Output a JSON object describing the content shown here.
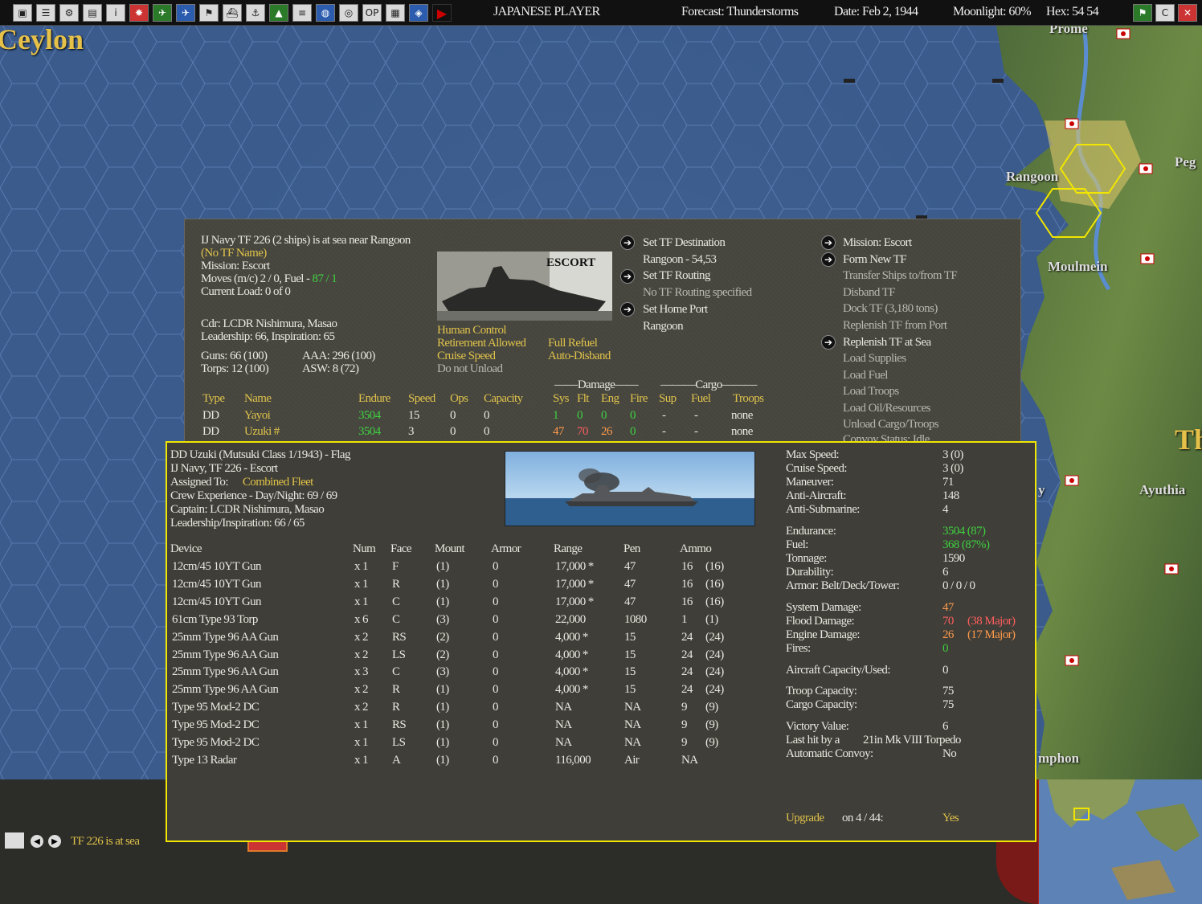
{
  "toolbar": {
    "icons": [
      "save-icon",
      "list-icon",
      "group-icon",
      "report-icon",
      "info-icon",
      "flag-icon",
      "plane-icon",
      "air-icon",
      "task-icon",
      "ship-icon",
      "port-icon",
      "base-icon",
      "tf-icon",
      "globe-icon",
      "intel-icon",
      "ops-icon",
      "menu-icon",
      "map-icon"
    ],
    "ops_label": "OP",
    "player": "JAPANESE PLAYER",
    "forecast": "Forecast: Thunderstorms",
    "date": "Date: Feb 2, 1944",
    "moonlight": "Moonlight: 60%",
    "hex": "Hex: 54  54"
  },
  "map": {
    "labels": {
      "ceylon": "Ceylon",
      "prome": "Prome",
      "rangoon": "Rangoon",
      "moulmein": "Moulmein",
      "peg": "Peg",
      "ayuthia": "Ayuthia",
      "th": "Th",
      "mphon": "mphon",
      "y": "y"
    }
  },
  "tf": {
    "header": "IJ Navy TF 226 (2 ships) is at sea near Rangoon",
    "name": "(No TF Name)",
    "mission": "Mission:  Escort",
    "moves": "Moves (m/c)  2 / 0, Fuel - ",
    "fuel": "87 / 1",
    "load": "Current Load:  0 of 0",
    "commander": "Cdr: LCDR  Nishimura, Masao",
    "leadership": "Leadership: 66, Inspiration: 65",
    "guns": "Guns: 66 (100)",
    "aaa": "AAA: 296 (100)",
    "torps": "Torps: 12 (100)",
    "asw": "ASW: 8 (72)",
    "image_caption": "ESCORT",
    "options": {
      "human": "Human Control",
      "retire": "Retirement Allowed",
      "cruise": "Cruise Speed",
      "unload": "Do not Unload",
      "refuel": "Full Refuel",
      "disband": "Auto-Disband"
    },
    "mid_menu": [
      "Set TF Destination",
      "Rangoon - 54,53",
      "Set TF Routing",
      "No TF Routing specified",
      "Set Home Port",
      "Rangoon"
    ],
    "right_menu": [
      "Mission: Escort",
      "Form New TF",
      "Transfer Ships to/from TF",
      "Disband TF",
      "Dock TF (3,180 tons)",
      "Replenish TF from Port",
      "Replenish TF at Sea",
      "Load Supplies",
      "Load Fuel",
      "Load Troops",
      "Load Oil/Resources",
      "Unload Cargo/Troops",
      "Convoy Status: Idle"
    ],
    "group_damage": "Damage",
    "group_cargo": "Cargo",
    "columns": [
      "Type",
      "Name",
      "Endure",
      "Speed",
      "Ops",
      "Capacity",
      "Sys",
      "Flt",
      "Eng",
      "Fire",
      "Sup",
      "Fuel",
      "Troops"
    ],
    "rows": [
      {
        "type": "DD",
        "name": "Yayoi",
        "endure": "3504",
        "speed": "15",
        "ops": "0",
        "capacity": "0",
        "sys": "1",
        "flt": "0",
        "eng": "0",
        "fire": "0",
        "sup": "-",
        "fuel": "-",
        "troops": "none"
      },
      {
        "type": "DD",
        "name": "Uzuki #",
        "endure": "3504",
        "speed": "3",
        "ops": "0",
        "capacity": "0",
        "sys": "47",
        "flt": "70",
        "eng": "26",
        "fire": "0",
        "sup": "-",
        "fuel": "-",
        "troops": "none"
      }
    ]
  },
  "ship": {
    "title": "DD Uzuki (Mutsuki Class 1/1943) - Flag",
    "navy": "IJ Navy, TF 226 - Escort",
    "assigned_label": "Assigned To:",
    "assigned": "Combined Fleet",
    "crew": "Crew Experience - Day/Night:  69 / 69",
    "captain": "Captain:  LCDR  Nishimura, Masao",
    "leadership": "Leadership/Inspiration: 66 / 65",
    "columns": [
      "Device",
      "Num",
      "Face",
      "Mount",
      "Armor",
      "Range",
      "Pen",
      "Ammo"
    ],
    "devices": [
      {
        "d": "12cm/45 10YT Gun",
        "n": "x 1",
        "f": "F",
        "m": "(1)",
        "a": "0",
        "r": "17,000 *",
        "p": "47",
        "am": "16",
        "ammax": "(16)"
      },
      {
        "d": "12cm/45 10YT Gun",
        "n": "x 1",
        "f": "R",
        "m": "(1)",
        "a": "0",
        "r": "17,000 *",
        "p": "47",
        "am": "16",
        "ammax": "(16)"
      },
      {
        "d": "12cm/45 10YT Gun",
        "n": "x 1",
        "f": "C",
        "m": "(1)",
        "a": "0",
        "r": "17,000 *",
        "p": "47",
        "am": "16",
        "ammax": "(16)"
      },
      {
        "d": "61cm Type 93 Torp",
        "n": "x 6",
        "f": "C",
        "m": "(3)",
        "a": "0",
        "r": "22,000",
        "p": "1080",
        "am": "1",
        "ammax": "(1)"
      },
      {
        "d": "25mm Type 96 AA Gun",
        "n": "x 2",
        "f": "RS",
        "m": "(2)",
        "a": "0",
        "r": "4,000 *",
        "p": "15",
        "am": "24",
        "ammax": "(24)"
      },
      {
        "d": "25mm Type 96 AA Gun",
        "n": "x 2",
        "f": "LS",
        "m": "(2)",
        "a": "0",
        "r": "4,000 *",
        "p": "15",
        "am": "24",
        "ammax": "(24)"
      },
      {
        "d": "25mm Type 96 AA Gun",
        "n": "x 3",
        "f": "C",
        "m": "(3)",
        "a": "0",
        "r": "4,000 *",
        "p": "15",
        "am": "24",
        "ammax": "(24)"
      },
      {
        "d": "25mm Type 96 AA Gun",
        "n": "x 2",
        "f": "R",
        "m": "(1)",
        "a": "0",
        "r": "4,000 *",
        "p": "15",
        "am": "24",
        "ammax": "(24)"
      },
      {
        "d": "Type 95 Mod-2 DC",
        "n": "x 2",
        "f": "R",
        "m": "(1)",
        "a": "0",
        "r": "NA",
        "p": "NA",
        "am": "9",
        "ammax": "(9)"
      },
      {
        "d": "Type 95 Mod-2 DC",
        "n": "x 1",
        "f": "RS",
        "m": "(1)",
        "a": "0",
        "r": "NA",
        "p": "NA",
        "am": "9",
        "ammax": "(9)"
      },
      {
        "d": "Type 95 Mod-2 DC",
        "n": "x 1",
        "f": "LS",
        "m": "(1)",
        "a": "0",
        "r": "NA",
        "p": "NA",
        "am": "9",
        "ammax": "(9)"
      },
      {
        "d": "Type 13 Radar",
        "n": "x 1",
        "f": "A",
        "m": "(1)",
        "a": "0",
        "r": "116,000",
        "p": "Air",
        "am": "NA",
        "ammax": ""
      }
    ],
    "stats": {
      "max_speed_l": "Max Speed:",
      "max_speed": "3 (0)",
      "cruise_l": "Cruise Speed:",
      "cruise": "3 (0)",
      "maneuver_l": "Maneuver:",
      "maneuver": "71",
      "aa_l": "Anti-Aircraft:",
      "aa": "148",
      "asub_l": "Anti-Submarine:",
      "asub": "4",
      "endurance_l": "Endurance:",
      "endurance": "3504 (87)",
      "fuel_l": "Fuel:",
      "fuel": "368 (87%)",
      "tonnage_l": "Tonnage:",
      "tonnage": "1590",
      "durability_l": "Durability:",
      "durability": "6",
      "armor_l": "Armor: Belt/Deck/Tower:",
      "armor": "0 / 0 / 0",
      "sysdmg_l": "System Damage:",
      "sysdmg": "47",
      "flood_l": "Flood Damage:",
      "flood": "70",
      "flood_major": "(38 Major)",
      "engine_l": "Engine Damage:",
      "engine": "26",
      "engine_major": "(17 Major)",
      "fires_l": "Fires:",
      "fires": "0",
      "aircraft_l": "Aircraft Capacity/Used:",
      "aircraft": "0",
      "troop_l": "Troop Capacity:",
      "troop": "75",
      "cargo_l": "Cargo Capacity:",
      "cargo": "75",
      "victory_l": "Victory Value:",
      "victory": "6",
      "lasthit_l": "Last hit by a",
      "lasthit": "21in Mk VIII Torpedo",
      "convoy_l": "Automatic Convoy:",
      "convoy": "No",
      "upgrade_l": "Upgrade",
      "upgrade_on": "on  4 / 44:",
      "upgrade": "Yes"
    }
  },
  "status": {
    "message": "TF 226 is at sea"
  },
  "colors": {
    "gold": "#e0c24a",
    "green": "#3fd13f",
    "red": "#ff5f5f",
    "orange": "#ff9a4a",
    "highlight": "#f2e600",
    "sea": "#3a5b8c"
  }
}
